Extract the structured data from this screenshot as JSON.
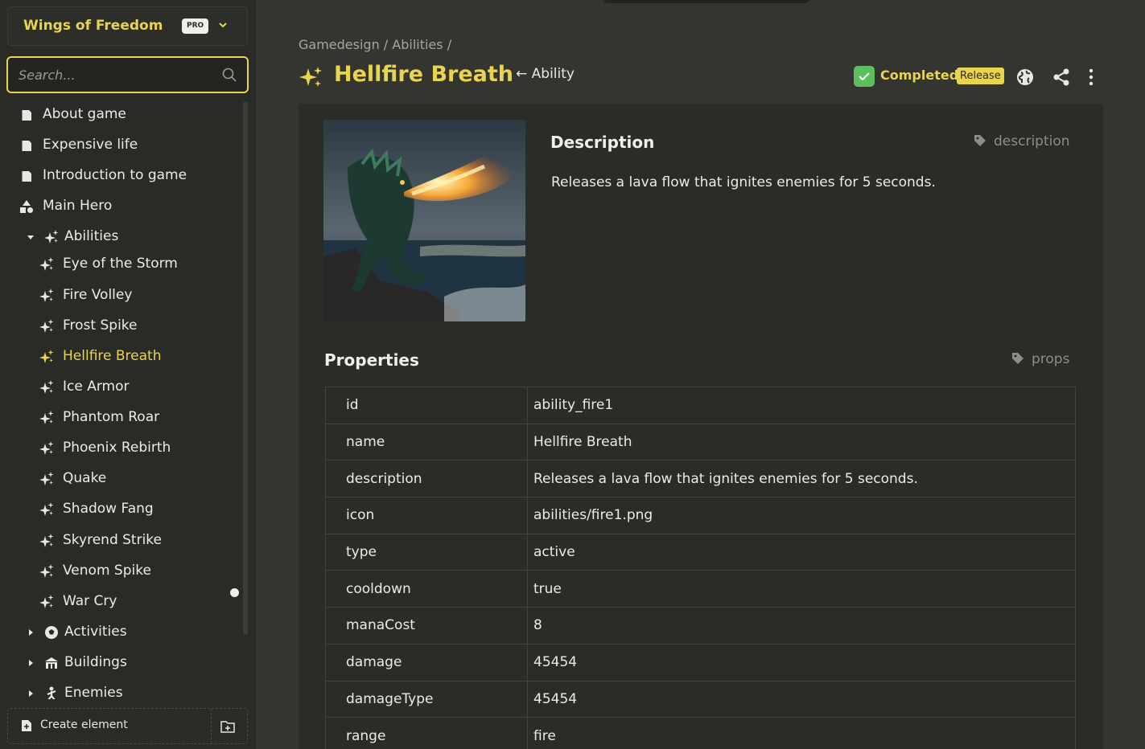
{
  "project": {
    "name": "Wings of Freedom",
    "plan_badge": "PRO"
  },
  "search": {
    "placeholder": "Search..."
  },
  "sidebar": {
    "items": [
      {
        "label": "About game",
        "icon": "book-icon",
        "active": false
      },
      {
        "label": "Expensive life",
        "icon": "book-icon",
        "active": false
      },
      {
        "label": "Introduction to game",
        "icon": "book-icon",
        "active": false
      },
      {
        "label": "Main Hero",
        "icon": "shapes-icon",
        "active": false
      },
      {
        "label": "Abilities",
        "icon": "sparkles-icon",
        "active": false,
        "expanded": true
      },
      {
        "label": "Eye of the Storm",
        "icon": "sparkles-icon",
        "active": false
      },
      {
        "label": "Fire Volley",
        "icon": "sparkles-icon",
        "active": false
      },
      {
        "label": "Frost Spike",
        "icon": "sparkles-icon",
        "active": false
      },
      {
        "label": "Hellfire Breath",
        "icon": "sparkles-icon",
        "active": true
      },
      {
        "label": "Ice Armor",
        "icon": "sparkles-icon",
        "active": false
      },
      {
        "label": "Phantom Roar",
        "icon": "sparkles-icon",
        "active": false
      },
      {
        "label": "Phoenix Rebirth",
        "icon": "sparkles-icon",
        "active": false
      },
      {
        "label": "Quake",
        "icon": "sparkles-icon",
        "active": false
      },
      {
        "label": "Shadow Fang",
        "icon": "sparkles-icon",
        "active": false
      },
      {
        "label": "Skyrend Strike",
        "icon": "sparkles-icon",
        "active": false
      },
      {
        "label": "Venom Spike",
        "icon": "sparkles-icon",
        "active": false
      },
      {
        "label": "War Cry",
        "icon": "sparkles-icon",
        "active": false
      },
      {
        "label": "Activities",
        "icon": "ball-icon",
        "active": false,
        "expanded": false
      },
      {
        "label": "Buildings",
        "icon": "building-icon",
        "active": false,
        "expanded": false
      },
      {
        "label": "Enemies",
        "icon": "figure-icon",
        "active": false,
        "expanded": false
      }
    ],
    "create_label": "Create element"
  },
  "header": {
    "breadcrumb": "Gamedesign / Abilities /",
    "title": "Hellfire Breath",
    "type_link": "← Ability",
    "status_label": "Completed",
    "release_badge": "Release"
  },
  "description": {
    "title": "Description",
    "tag": "description",
    "text": "Releases a lava flow that ignites enemies for 5 seconds."
  },
  "properties": {
    "title": "Properties",
    "tag": "props",
    "rows": [
      {
        "key": "id",
        "value": "ability_fire1"
      },
      {
        "key": "name",
        "value": "Hellfire Breath"
      },
      {
        "key": "description",
        "value": "Releases a lava flow that ignites enemies for 5 seconds."
      },
      {
        "key": "icon",
        "value": "abilities/fire1.png"
      },
      {
        "key": "type",
        "value": "active"
      },
      {
        "key": "cooldown",
        "value": "true"
      },
      {
        "key": "manaCost",
        "value": "8"
      },
      {
        "key": "damage",
        "value": "45454"
      },
      {
        "key": "damageType",
        "value": "45454"
      },
      {
        "key": "range",
        "value": "fire"
      }
    ]
  },
  "colors": {
    "accent": "#e8d44d",
    "status_green": "#5bbf5e",
    "background": "#343430",
    "sidebar": "#2a2a27"
  }
}
